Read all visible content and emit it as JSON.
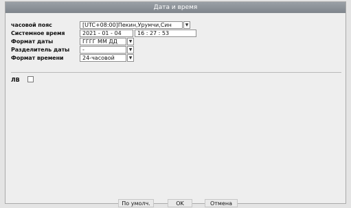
{
  "window": {
    "title": "Дата и время"
  },
  "settings": {
    "timezone": {
      "label": "часовой пояс",
      "value": "[UTC+08:00]Пекин,Урумчи,Син"
    },
    "system_time": {
      "label": "Системное время",
      "date": "2021 - 01 - 04",
      "time": "16 : 27 : 53"
    },
    "date_format": {
      "label": "Формат даты",
      "value": "ГГГГ ММ ДД"
    },
    "date_separator": {
      "label": "Разделитель даты",
      "value": "-"
    },
    "time_format": {
      "label": "Формат времени",
      "value": "24-часовой"
    }
  },
  "dst": {
    "label": "ЛВ",
    "checked": false
  },
  "buttons": {
    "default": "По умолч.",
    "ok": "OK",
    "cancel": "Отмена"
  },
  "icons": {
    "dropdown": "chevron-down-icon"
  }
}
